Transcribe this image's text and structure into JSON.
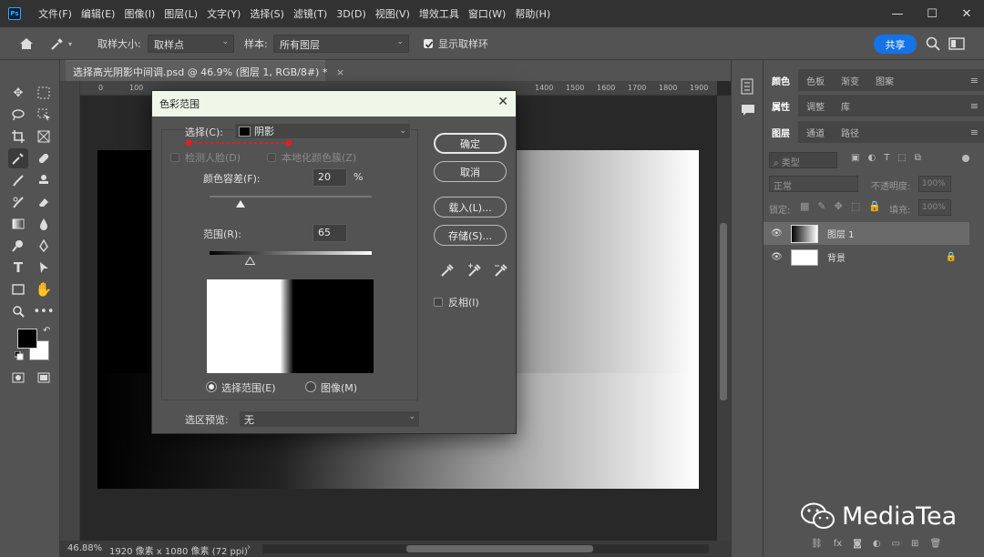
{
  "menubar": {
    "logo": "Ps",
    "items": [
      "文件(F)",
      "编辑(E)",
      "图像(I)",
      "图层(L)",
      "文字(Y)",
      "选择(S)",
      "滤镜(T)",
      "3D(D)",
      "视图(V)",
      "增效工具",
      "窗口(W)",
      "帮助(H)"
    ],
    "minimize": "—",
    "maximize": "☐",
    "close": "✕"
  },
  "options": {
    "sample_size_label": "取样大小:",
    "sample_size_value": "取样点",
    "sample_label": "样本:",
    "sample_value": "所有图层",
    "show_ring_label": "显示取样环",
    "share": "共享"
  },
  "document": {
    "tab_title": "选择高光阴影中间调.psd @ 46.9% (图层 1, RGB/8#) *",
    "tab_close": "×",
    "ruler_ticks": [
      "0",
      "100",
      "",
      "",
      "",
      "",
      "",
      "",
      "",
      "",
      "",
      "",
      "",
      "",
      "1400",
      "1500",
      "1600",
      "1700",
      "1800",
      "1900"
    ],
    "zoom": "46.88%",
    "doc_info": "1920 像素 x 1080 像素 (72 ppi)"
  },
  "dialog": {
    "title": "色彩范围",
    "close": "✕",
    "select_label": "选择(C):",
    "select_value": "阴影",
    "detect_faces": "检测人脸(D)",
    "localized_clusters": "本地化颜色簇(Z)",
    "fuzziness_label": "颜色容差(F):",
    "fuzziness_value": "20",
    "fuzziness_unit": "%",
    "range_label": "范围(R):",
    "range_value": "65",
    "radio_selection": "选择范围(E)",
    "radio_image": "图像(M)",
    "preview_label": "选区预览:",
    "preview_value": "无",
    "ok": "确定",
    "cancel": "取消",
    "load": "载入(L)...",
    "save": "存储(S)...",
    "invert": "反相(I)"
  },
  "panels": {
    "tabs1": [
      "颜色",
      "色板",
      "渐变",
      "图案"
    ],
    "tabs2": [
      "属性",
      "调整",
      "库"
    ],
    "tabs3": [
      "图层",
      "通道",
      "路径"
    ],
    "kind_filter": "类型",
    "blend_mode": "正常",
    "opacity_label": "不透明度:",
    "opacity_value": "100%",
    "lock_label": "锁定:",
    "fill_label": "填充:",
    "fill_value": "100%",
    "layers": [
      {
        "name": "图层 1"
      },
      {
        "name": "背景"
      }
    ]
  },
  "watermark": "MediaTea"
}
